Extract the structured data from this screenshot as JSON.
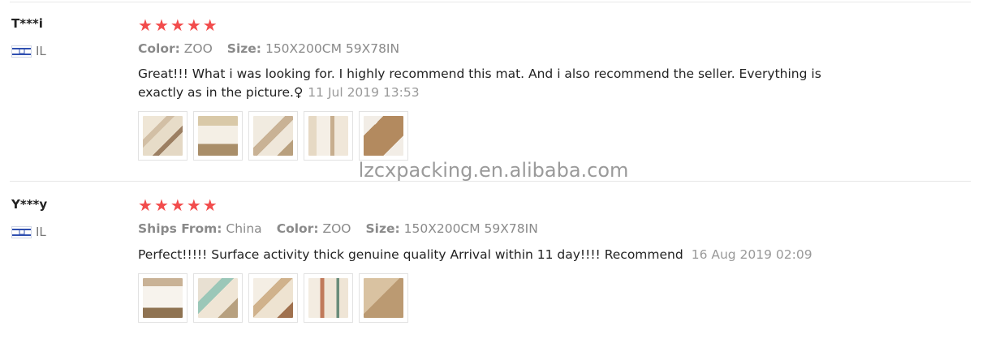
{
  "reviews": [
    {
      "user": "T***i",
      "country": "IL",
      "rating": 5,
      "meta": [
        {
          "key": "Color:",
          "value": "ZOO"
        },
        {
          "key": "Size:",
          "value": "150X200CM 59X78IN"
        }
      ],
      "text": "Great!!! What i was looking for. I highly recommend this mat. And i also recommend the seller. Everything is exactly as in the picture.",
      "emoji": "♀",
      "date": "11 Jul 2019 13:53",
      "photos": [
        "p-a",
        "p-b",
        "p-c",
        "p-d",
        "p-e"
      ]
    },
    {
      "user": "Y***y",
      "country": "IL",
      "rating": 5,
      "meta": [
        {
          "key": "Ships From:",
          "value": "China"
        },
        {
          "key": "Color:",
          "value": "ZOO"
        },
        {
          "key": "Size:",
          "value": "150X200CM 59X78IN"
        }
      ],
      "text": "Perfect!!!!! Surface activity thick genuine quality Arrival within 11 day!!!! Recommend",
      "date": "16 Aug 2019 02:09",
      "photos": [
        "p-f",
        "p-g",
        "p-h",
        "p-i",
        "p-j"
      ]
    }
  ],
  "watermark": "lzcxpacking.en.alibaba.com",
  "colors": {
    "star": "#f24c4c",
    "flag_blue": "#2f4fb0",
    "muted": "#8a8a8a"
  },
  "icons": {
    "star": "star-icon",
    "flag": "israel-flag-icon"
  }
}
